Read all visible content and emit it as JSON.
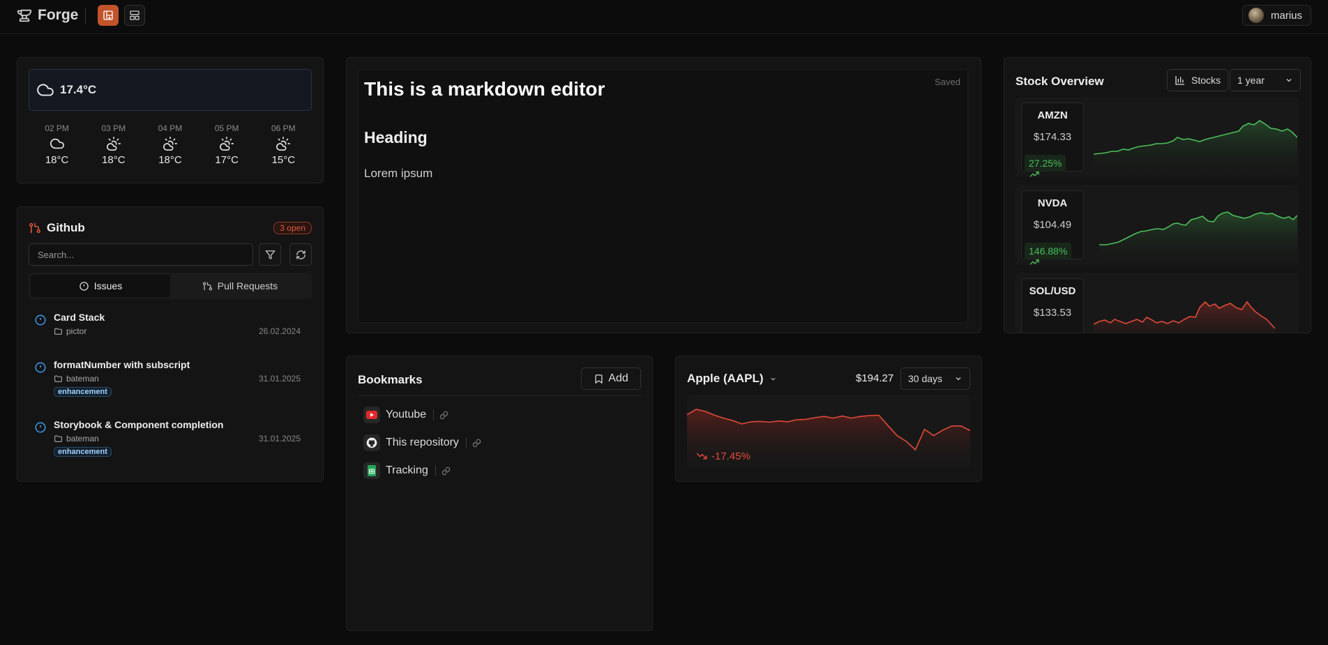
{
  "header": {
    "app_name": "Forge",
    "user_name": "marius"
  },
  "weather": {
    "current": "17.4°C",
    "hours": [
      {
        "time": "02 PM",
        "temp": "18°C",
        "icon": "cloud-icon"
      },
      {
        "time": "03 PM",
        "temp": "18°C",
        "icon": "cloud-sun-icon"
      },
      {
        "time": "04 PM",
        "temp": "18°C",
        "icon": "cloud-sun-icon"
      },
      {
        "time": "05 PM",
        "temp": "17°C",
        "icon": "cloud-sun-icon"
      },
      {
        "time": "06 PM",
        "temp": "15°C",
        "icon": "cloud-sun-icon"
      }
    ]
  },
  "github": {
    "title": "Github",
    "open_badge": "3 open",
    "search_placeholder": "Search...",
    "tabs": [
      "Issues",
      "Pull Requests"
    ],
    "issues": [
      {
        "title": "Card Stack",
        "repo": "pictor",
        "date": "26.02.2024",
        "label": ""
      },
      {
        "title": "formatNumber with subscript",
        "repo": "bateman",
        "date": "31.01.2025",
        "label": "enhancement"
      },
      {
        "title": "Storybook & Component completion",
        "repo": "bateman",
        "date": "31.01.2025",
        "label": "enhancement"
      }
    ]
  },
  "editor": {
    "h1": "This is a markdown editor",
    "h2": "Heading",
    "paragraph": "Lorem ipsum",
    "status": "Saved"
  },
  "stocks": {
    "title": "Stock Overview",
    "type_button": "Stocks",
    "range": "1 year",
    "items": [
      {
        "symbol": "AMZN",
        "price": "$174.33",
        "change": "27.25%",
        "trend": "up"
      },
      {
        "symbol": "NVDA",
        "price": "$104.49",
        "change": "146.88%",
        "trend": "up"
      },
      {
        "symbol": "SOL/USD",
        "price": "$133.53",
        "change": "",
        "trend": "down"
      }
    ]
  },
  "bookmarks": {
    "title": "Bookmarks",
    "add_label": "Add",
    "items": [
      {
        "name": "Youtube",
        "icon": "youtube-icon"
      },
      {
        "name": "This repository",
        "icon": "github-icon"
      },
      {
        "name": "Tracking",
        "icon": "sheet-icon"
      }
    ]
  },
  "apple": {
    "title": "Apple (AAPL)",
    "price": "$194.27",
    "range": "30 days",
    "change": "-17.45%",
    "series": [
      67.0,
      68.3,
      67.8,
      66.9,
      66.2,
      65.6,
      64.8,
      65.3,
      65.4,
      65.2,
      65.5,
      65.3,
      65.8,
      65.9,
      66.3,
      66.6,
      66.2,
      66.7,
      66.2,
      66.6,
      66.8,
      66.9,
      64.4,
      62.0,
      60.6,
      58.6,
      63.5,
      62.0,
      63.3,
      64.3,
      64.3,
      63.2
    ],
    "colors": {
      "line": "#e04a3a"
    }
  },
  "colors": {
    "accent": "#c2532a",
    "up": "#4cbf5c",
    "down": "#e04a3a"
  }
}
